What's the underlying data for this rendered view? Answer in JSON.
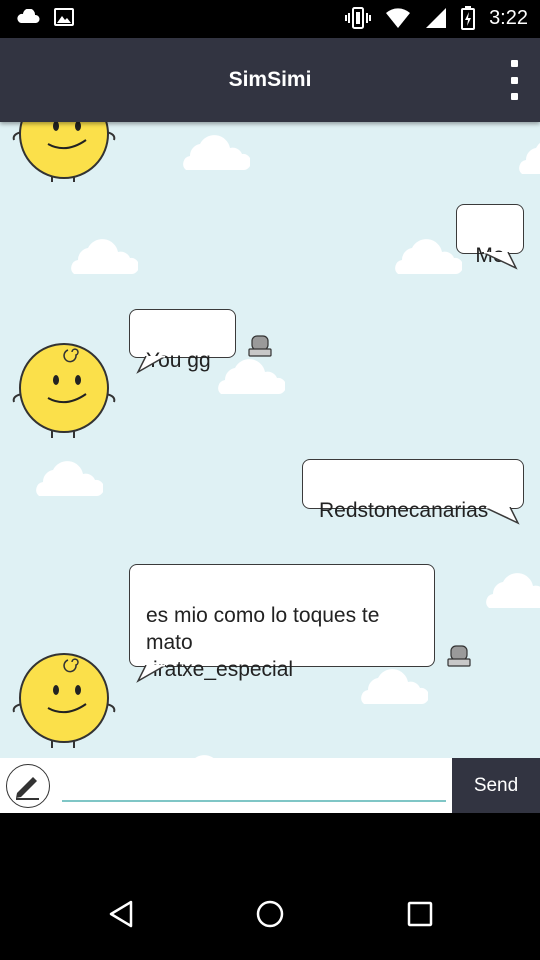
{
  "status_bar": {
    "time": "3:22"
  },
  "app_bar": {
    "title": "SimSimi"
  },
  "messages": [
    {
      "side": "right",
      "text": "Me"
    },
    {
      "side": "left",
      "text": "You gg"
    },
    {
      "side": "right",
      "text": "Redstonecanarias"
    },
    {
      "side": "left",
      "text": "es mio como lo toques te\nmato\n-iratxe_especial"
    }
  ],
  "input": {
    "value": "",
    "send_label": "Send"
  },
  "colors": {
    "app_bar": "#323441",
    "chat_bg": "#dff1f4",
    "avatar": "#fbe04a",
    "input_underline": "#7fc6c6"
  }
}
